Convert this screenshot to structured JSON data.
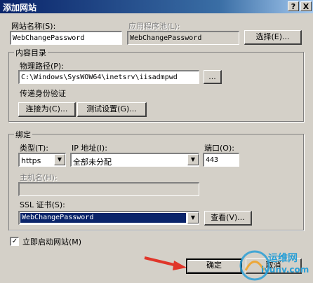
{
  "window": {
    "title": "添加网站",
    "help_glyph": "?",
    "close_glyph": "X"
  },
  "site_name": {
    "label": "网站名称(S):",
    "value": "WebChangePassword"
  },
  "app_pool": {
    "label": "应用程序池(L):",
    "value": "WebChangePassword",
    "select_label": "选择(E)..."
  },
  "content_dir": {
    "group_label": "内容目录",
    "physical_path_label": "物理路径(P):",
    "physical_path_value": "C:\\Windows\\SysWOW64\\inetsrv\\iisadmpwd",
    "browse_label": "...",
    "pass_through_label": "传递身份验证",
    "connect_as_label": "连接为(C)...",
    "test_settings_label": "测试设置(G)..."
  },
  "binding": {
    "group_label": "绑定",
    "type_label": "类型(T):",
    "type_value": "https",
    "ip_label": "IP 地址(I):",
    "ip_value": "全部未分配",
    "port_label": "端口(O):",
    "port_value": "443",
    "hostname_label": "主机名(H):",
    "hostname_value": "",
    "ssl_label": "SSL 证书(S):",
    "ssl_value": "WebChangePassword",
    "view_label": "查看(V)..."
  },
  "start_immediately": {
    "label": "立即启动网站(M)",
    "checked": true,
    "check_glyph": "✓"
  },
  "footer": {
    "ok_label": "确定",
    "cancel_label": "取消"
  },
  "watermark": {
    "line1": "运维网",
    "line2": "iyunv.com"
  },
  "colors": {
    "titlebar": "#0a246a",
    "selection": "#0a246a",
    "arrow": "#e0362a"
  }
}
